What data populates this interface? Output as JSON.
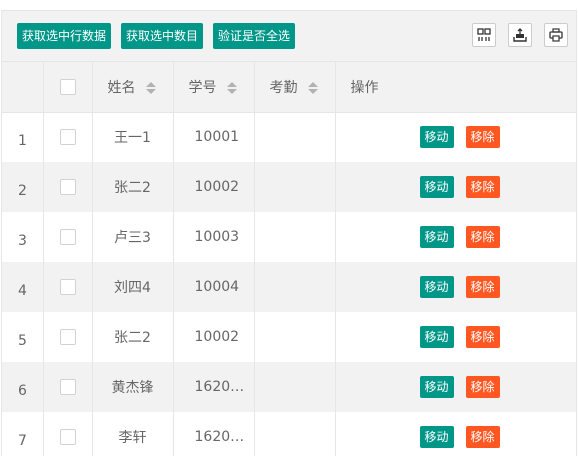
{
  "toolbar": {
    "buttons": [
      "获取选中行数据",
      "获取选中数目",
      "验证是否全选"
    ]
  },
  "headers": {
    "name": "姓名",
    "sid": "学号",
    "attend": "考勤",
    "ops": "操作"
  },
  "actions": {
    "move": "移动",
    "remove": "移除"
  },
  "rows": [
    {
      "n": "1",
      "name": "王一1",
      "sid": "10001",
      "attend": ""
    },
    {
      "n": "2",
      "name": "张二2",
      "sid": "10002",
      "attend": ""
    },
    {
      "n": "3",
      "name": "卢三3",
      "sid": "10003",
      "attend": ""
    },
    {
      "n": "4",
      "name": "刘四4",
      "sid": "10004",
      "attend": ""
    },
    {
      "n": "5",
      "name": "张二2",
      "sid": "10002",
      "attend": ""
    },
    {
      "n": "6",
      "name": "黄杰锋",
      "sid": "1620…",
      "attend": ""
    },
    {
      "n": "7",
      "name": "李轩",
      "sid": "1620…",
      "attend": ""
    }
  ]
}
